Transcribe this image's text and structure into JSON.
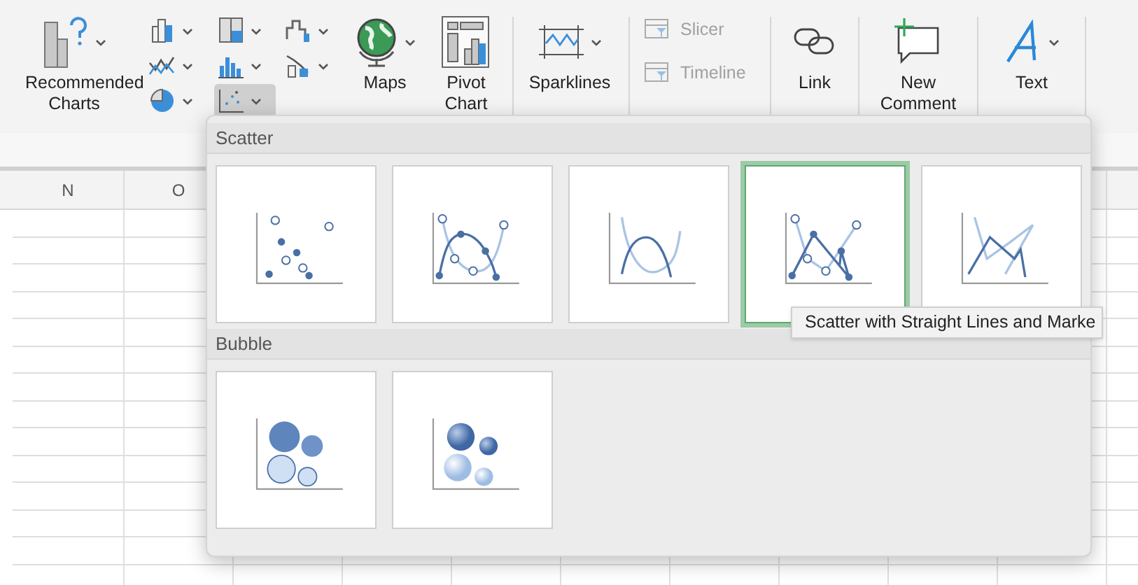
{
  "ribbon": {
    "recommended": {
      "label": "Recommended Charts"
    },
    "chart_types": [
      {
        "kind": "column",
        "selected": false
      },
      {
        "kind": "line",
        "selected": false
      },
      {
        "kind": "pie",
        "selected": false
      },
      {
        "kind": "hierarchy",
        "selected": false
      },
      {
        "kind": "statistic",
        "selected": false
      },
      {
        "kind": "scatter",
        "selected": true
      },
      {
        "kind": "waterfall",
        "selected": false
      },
      {
        "kind": "combo",
        "selected": false
      }
    ],
    "maps": {
      "label": "Maps"
    },
    "pivot_chart": {
      "label": "Pivot Chart"
    },
    "sparklines": {
      "label": "Sparklines"
    },
    "filters": [
      {
        "label": "Slicer",
        "disabled": true
      },
      {
        "label": "Timeline",
        "disabled": true
      }
    ],
    "link": {
      "label": "Link"
    },
    "new_comment": {
      "label": "New Comment"
    },
    "text": {
      "label": "Text"
    }
  },
  "sheet": {
    "columns": [
      "N",
      "O"
    ]
  },
  "gallery": {
    "sections": [
      {
        "title": "Scatter",
        "options": [
          {
            "kind": "markers",
            "selected": false
          },
          {
            "kind": "smooth_markers",
            "selected": false
          },
          {
            "kind": "smooth",
            "selected": false
          },
          {
            "kind": "straight_markers",
            "selected": true
          },
          {
            "kind": "straight",
            "selected": false
          }
        ]
      },
      {
        "title": "Bubble",
        "options": [
          {
            "kind": "bubble",
            "selected": false
          },
          {
            "kind": "bubble_3d",
            "selected": false
          }
        ]
      }
    ]
  },
  "tooltip": "Scatter with Straight Lines and Marke"
}
